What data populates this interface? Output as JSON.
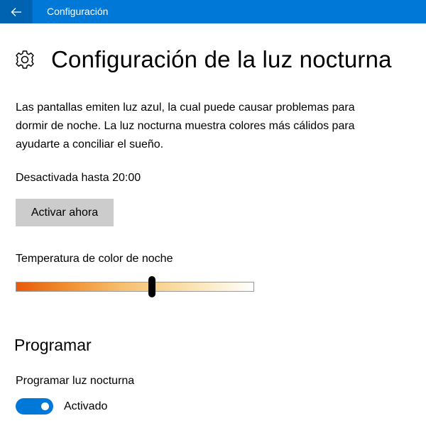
{
  "titlebar": {
    "back_icon": "back-arrow-icon",
    "title": "Configuración",
    "color": "#0078d7"
  },
  "header": {
    "icon": "gear-icon",
    "title": "Configuración de la luz nocturna"
  },
  "description": "Las pantallas emiten luz azul, la cual puede causar problemas para dormir de noche. La luz nocturna muestra colores más cálidos para ayudarte a conciliar el sueño.",
  "status": "Desactivada hasta 20:00",
  "activate_button": "Activar ahora",
  "temperature": {
    "label": "Temperatura de color de noche",
    "value_fraction": 0.57
  },
  "schedule": {
    "heading": "Programar",
    "toggle_label": "Programar luz nocturna",
    "toggle_on": true,
    "toggle_state": "Activado",
    "accent": "#0078d7"
  }
}
